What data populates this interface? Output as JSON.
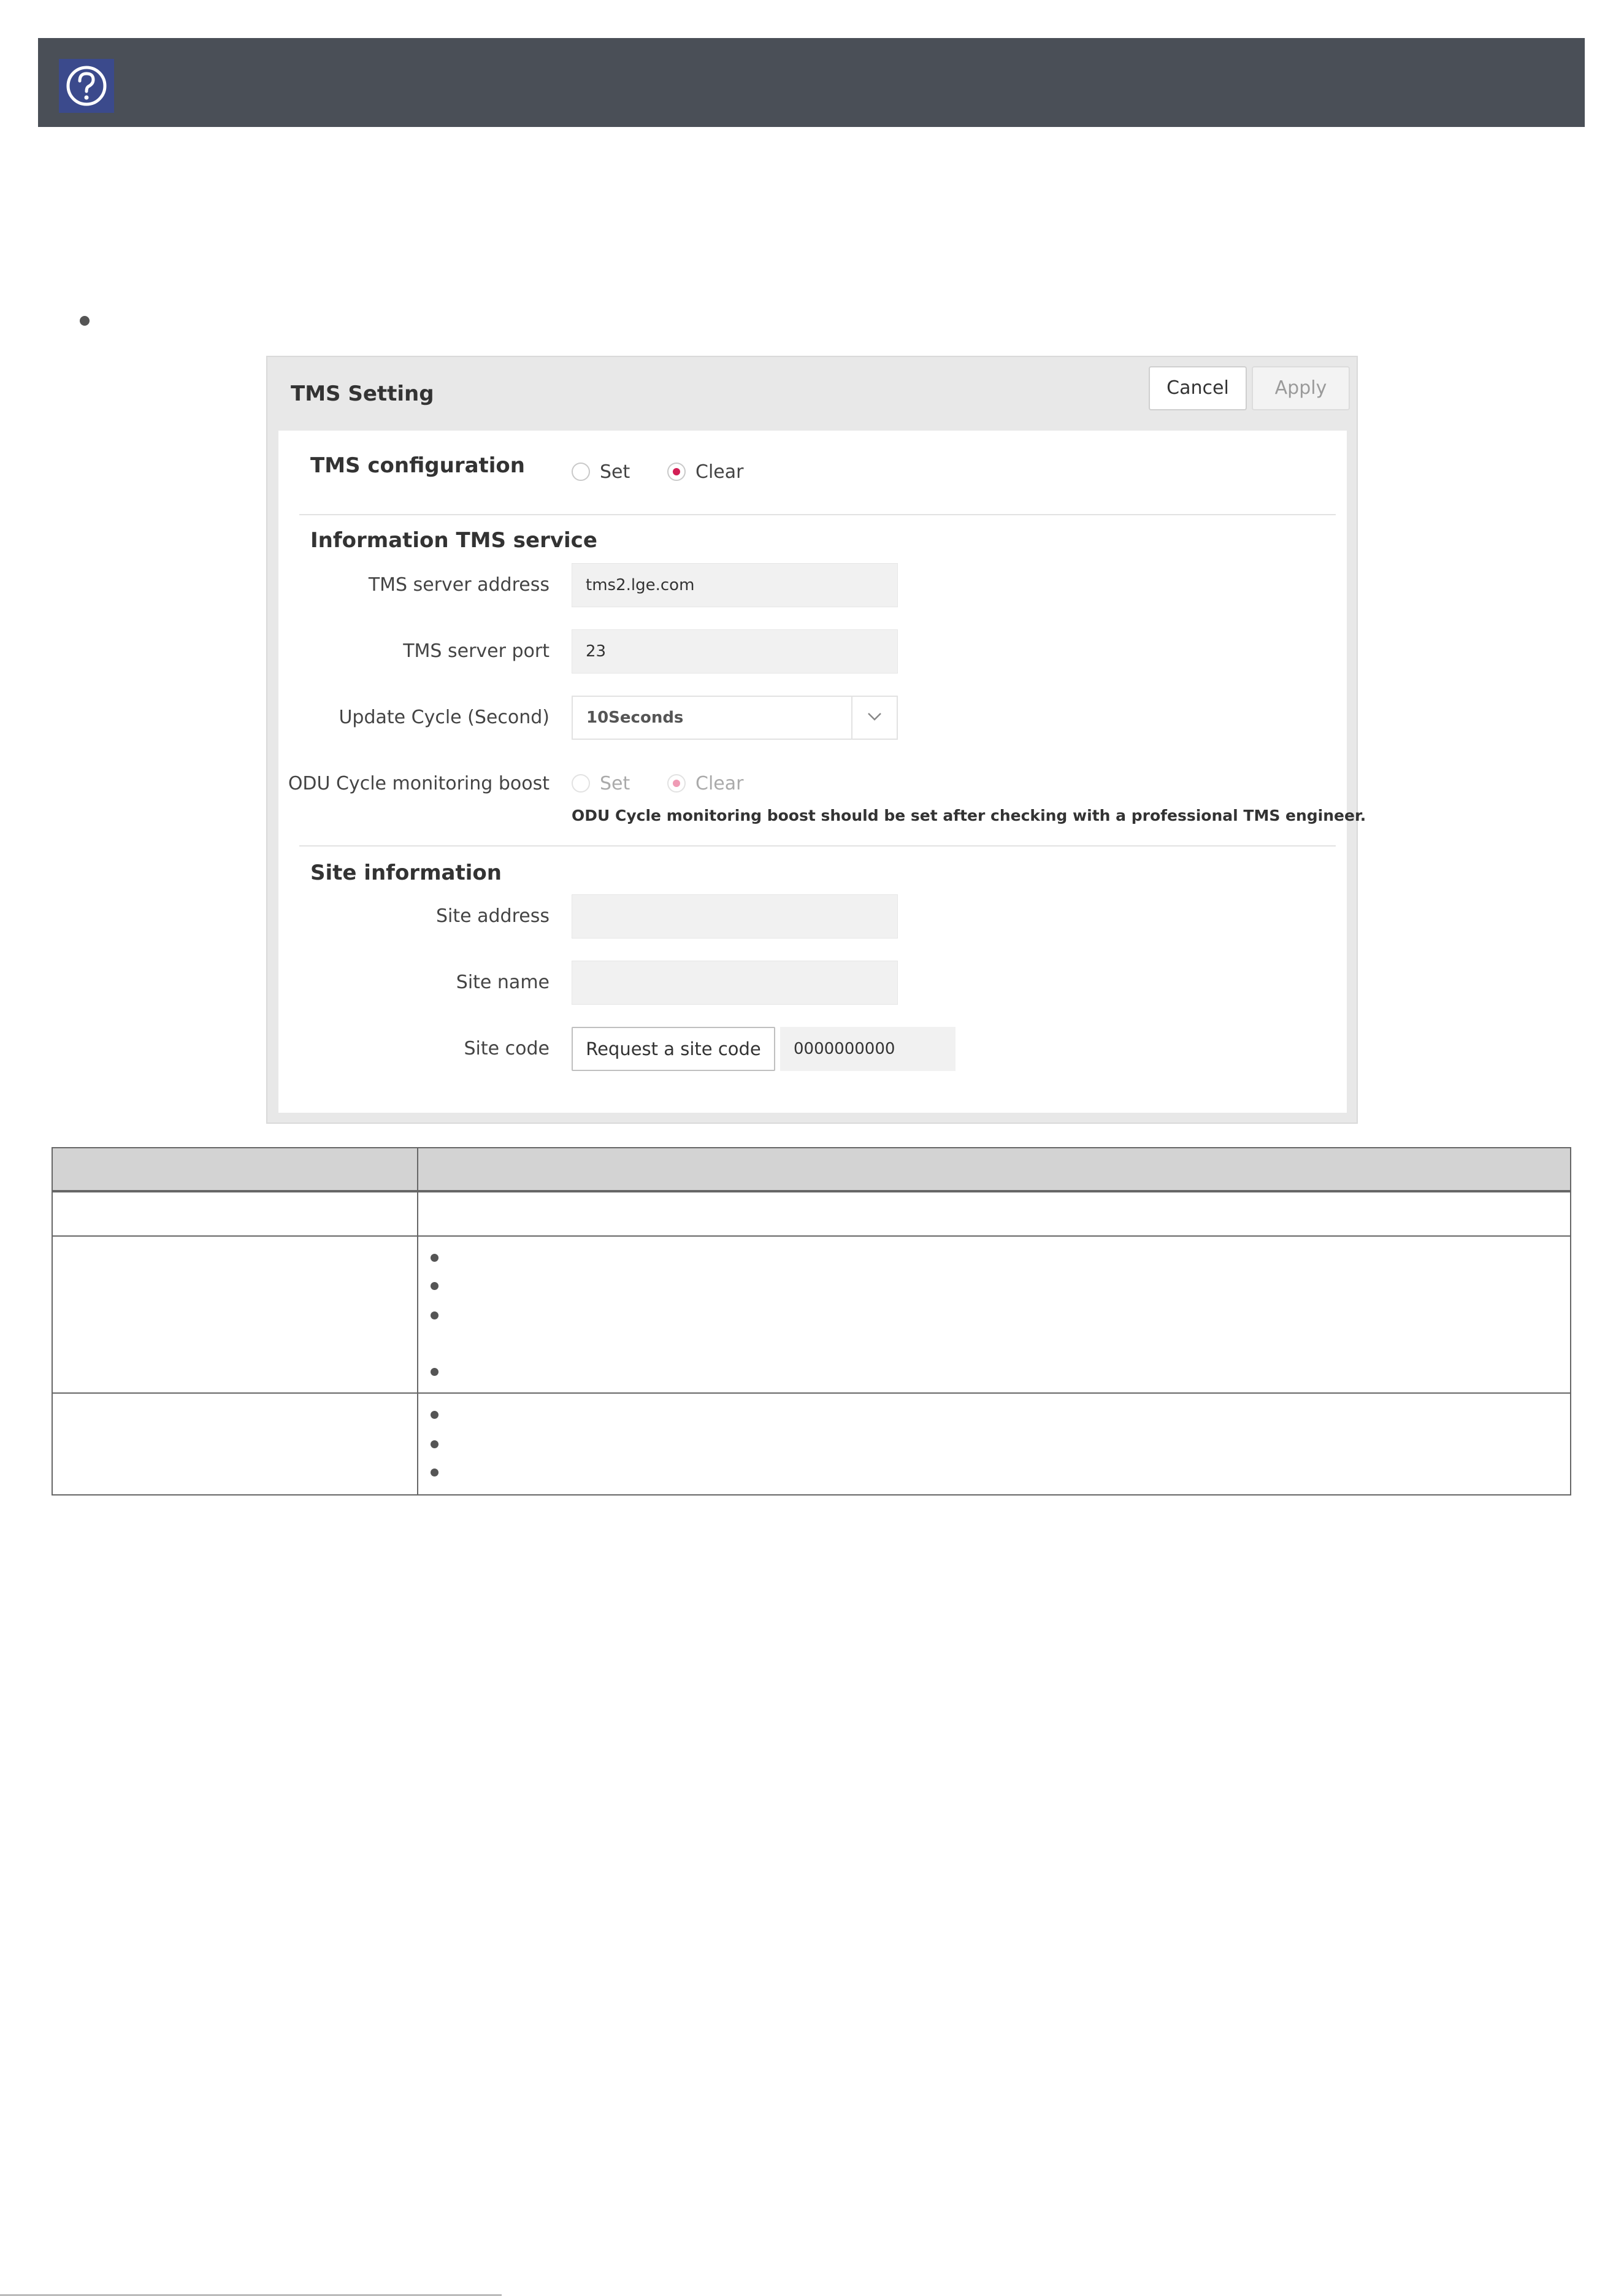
{
  "header": {
    "help_icon": "question-circle-icon"
  },
  "dialog": {
    "title": "TMS Setting",
    "cancel_label": "Cancel",
    "apply_label": "Apply",
    "tms_configuration": {
      "title": "TMS configuration",
      "options": [
        "Set",
        "Clear"
      ],
      "selected": "Clear"
    },
    "information_section": {
      "title": "Information TMS service",
      "server_address_label": "TMS server address",
      "server_address_value": "tms2.lge.com",
      "server_port_label": "TMS server port",
      "server_port_value": "23",
      "update_cycle_label": "Update Cycle (Second)",
      "update_cycle_value": "10Seconds",
      "odu_boost_label": "ODU Cycle monitoring boost",
      "odu_boost_options": [
        "Set",
        "Clear"
      ],
      "odu_boost_selected": "Clear",
      "odu_boost_warning": "ODU Cycle monitoring boost should be set after checking with a professional TMS engineer."
    },
    "site_section": {
      "title": "Site information",
      "site_address_label": "Site address",
      "site_address_value": "",
      "site_name_label": "Site name",
      "site_name_value": "",
      "site_code_label": "Site code",
      "request_code_label": "Request a site code",
      "site_code_value": "0000000000"
    }
  },
  "colors": {
    "header_bg": "#4a4f57",
    "help_icon_bg": "#3b4a8c",
    "radio_accent": "#d21f55"
  }
}
